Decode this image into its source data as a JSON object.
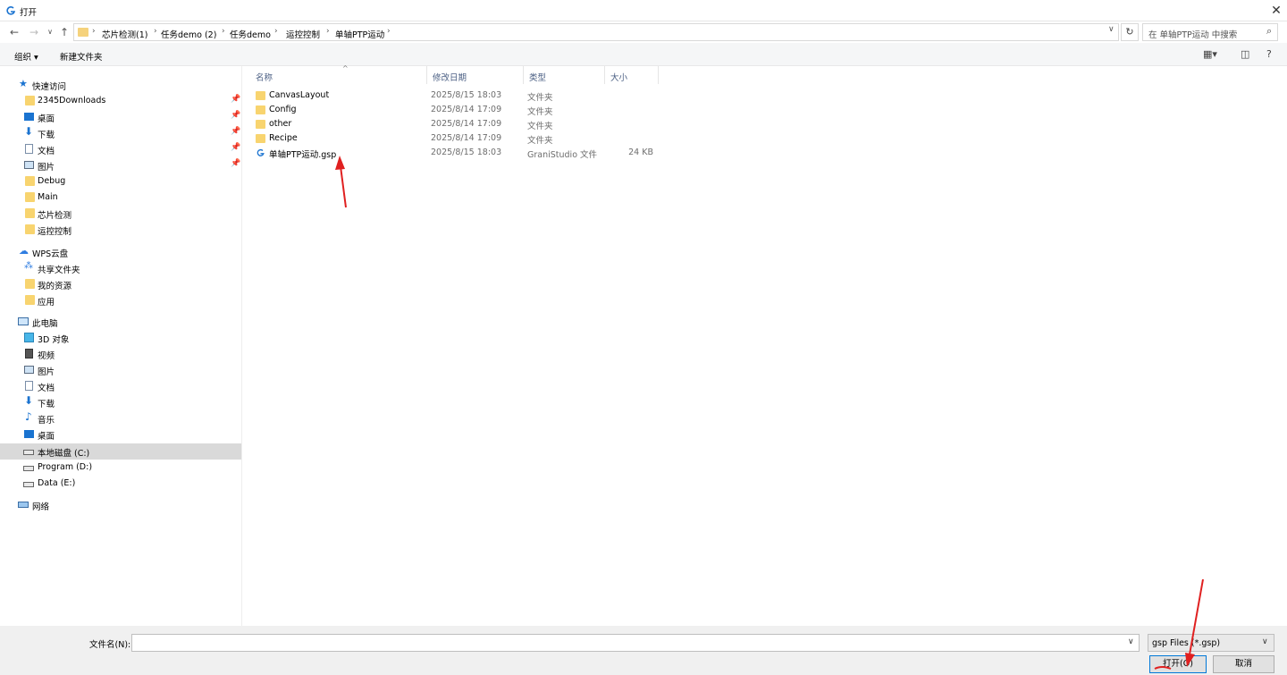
{
  "window": {
    "title": "打开",
    "close_icon": "close-icon"
  },
  "address": {
    "crumbs": [
      "芯片检测(1)",
      "任务demo (2)",
      "任务demo",
      "运控控制",
      "单轴PTP运动"
    ],
    "search_placeholder": "在 单轴PTP运动 中搜索"
  },
  "toolbar": {
    "organize_label": "组织 ▾",
    "new_folder_label": "新建文件夹"
  },
  "sidebar": {
    "quick_access": {
      "label": "快速访问",
      "items": [
        {
          "label": "2345Downloads",
          "icon": "folder-icon",
          "pinned": true
        },
        {
          "label": "桌面",
          "icon": "desktop-icon",
          "pinned": true
        },
        {
          "label": "下载",
          "icon": "download-icon",
          "pinned": true
        },
        {
          "label": "文档",
          "icon": "document-icon",
          "pinned": true
        },
        {
          "label": "图片",
          "icon": "picture-icon",
          "pinned": true
        },
        {
          "label": "Debug",
          "icon": "folder-icon",
          "pinned": false
        },
        {
          "label": "Main",
          "icon": "folder-icon",
          "pinned": false
        },
        {
          "label": "芯片检测",
          "icon": "folder-icon",
          "pinned": false
        },
        {
          "label": "运控控制",
          "icon": "folder-icon",
          "pinned": false
        }
      ]
    },
    "wps": {
      "label": "WPS云盘",
      "items": [
        {
          "label": "共享文件夹",
          "icon": "share-icon"
        },
        {
          "label": "我的资源",
          "icon": "folder-icon"
        },
        {
          "label": "应用",
          "icon": "folder-icon"
        }
      ]
    },
    "this_pc": {
      "label": "此电脑",
      "items": [
        {
          "label": "3D 对象",
          "icon": "cube-icon"
        },
        {
          "label": "视频",
          "icon": "video-icon"
        },
        {
          "label": "图片",
          "icon": "picture-icon"
        },
        {
          "label": "文档",
          "icon": "document-icon"
        },
        {
          "label": "下载",
          "icon": "download-icon"
        },
        {
          "label": "音乐",
          "icon": "music-icon"
        },
        {
          "label": "桌面",
          "icon": "desktop-icon"
        },
        {
          "label": "本地磁盘 (C:)",
          "icon": "drive-icon",
          "selected": true
        },
        {
          "label": "Program (D:)",
          "icon": "drive-icon"
        },
        {
          "label": "Data (E:)",
          "icon": "drive-icon"
        }
      ]
    },
    "network": {
      "label": "网络"
    }
  },
  "columns": {
    "name": "名称",
    "date": "修改日期",
    "type": "类型",
    "size": "大小"
  },
  "files": [
    {
      "name": "CanvasLayout",
      "date": "2025/8/15 18:03",
      "type": "文件夹",
      "size": "",
      "icon": "folder-icon"
    },
    {
      "name": "Config",
      "date": "2025/8/14 17:09",
      "type": "文件夹",
      "size": "",
      "icon": "folder-icon"
    },
    {
      "name": "other",
      "date": "2025/8/14 17:09",
      "type": "文件夹",
      "size": "",
      "icon": "folder-icon"
    },
    {
      "name": "Recipe",
      "date": "2025/8/14 17:09",
      "type": "文件夹",
      "size": "",
      "icon": "folder-icon"
    },
    {
      "name": "单轴PTP运动.gsp",
      "date": "2025/8/15 18:03",
      "type": "GraniStudio 文件",
      "size": "24 KB",
      "icon": "gsp-file-icon"
    }
  ],
  "bottom": {
    "filename_label": "文件名(N):",
    "filename_value": "",
    "filter_value": "gsp Files (*.gsp)",
    "open_label": "打开(O)",
    "cancel_label": "取消"
  },
  "colors": {
    "accent": "#0078d7",
    "annotation_arrow": "#e02020",
    "folder": "#f8d46f"
  }
}
